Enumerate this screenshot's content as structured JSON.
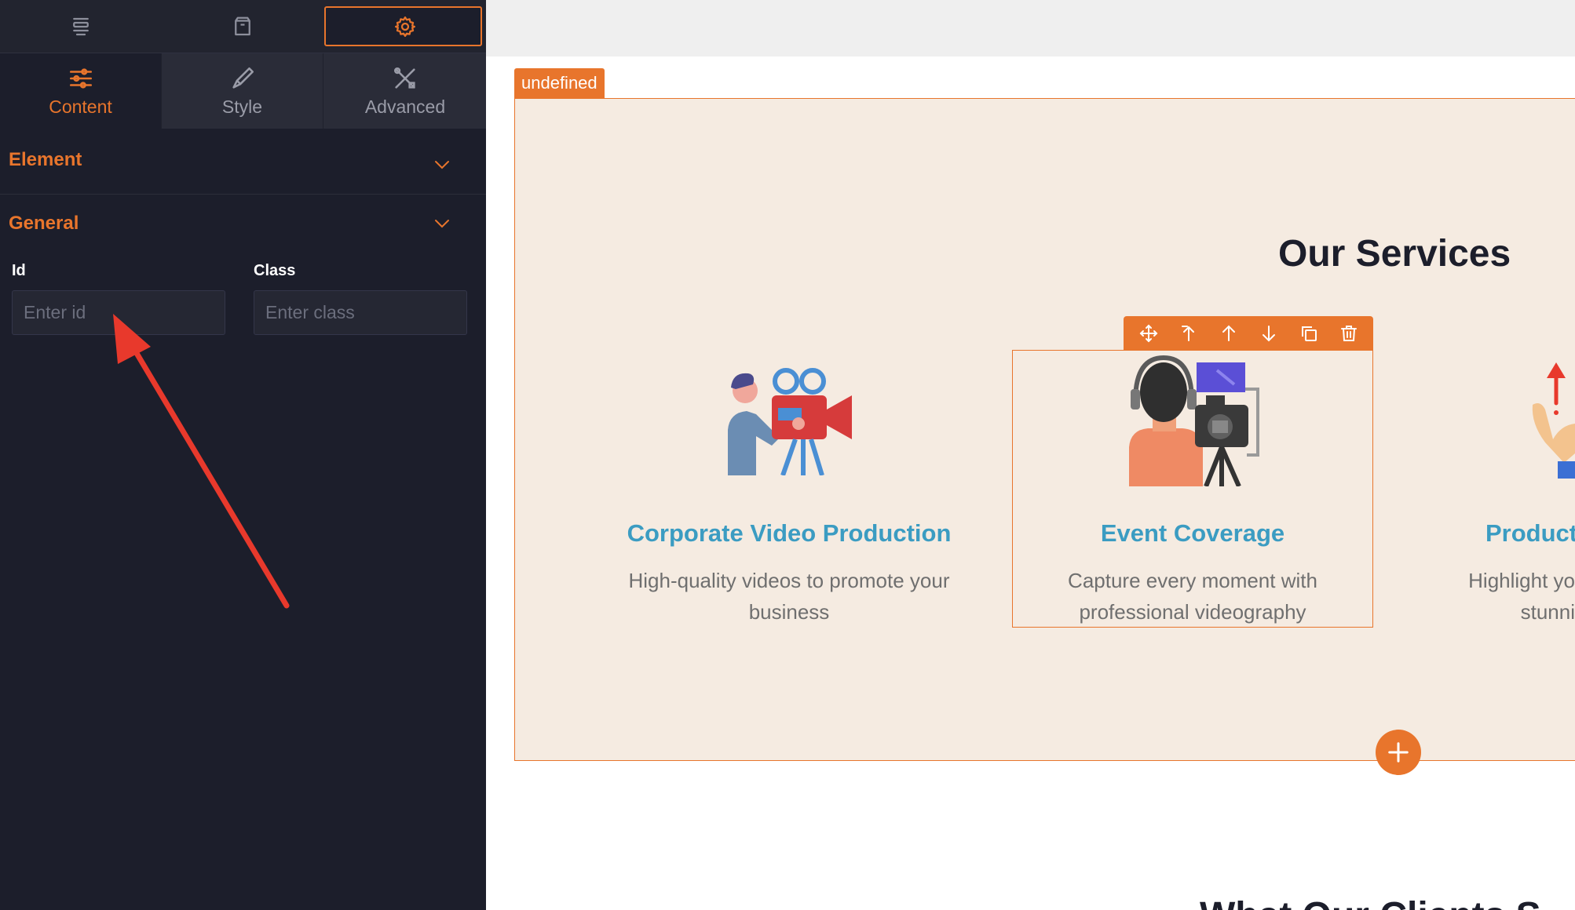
{
  "top_tabs": [
    {
      "icon": "layers-icon",
      "active": false
    },
    {
      "icon": "box-icon",
      "active": false
    },
    {
      "icon": "gear-icon",
      "active": true
    }
  ],
  "sub_tabs": [
    {
      "label": "Content",
      "icon": "sliders-icon",
      "active": true
    },
    {
      "label": "Style",
      "icon": "brush-icon",
      "active": false
    },
    {
      "label": "Advanced",
      "icon": "tools-icon",
      "active": false
    }
  ],
  "sections": {
    "element": {
      "title": "Element"
    },
    "general": {
      "title": "General"
    }
  },
  "fields": {
    "id": {
      "label": "Id",
      "placeholder": "Enter id",
      "value": ""
    },
    "class": {
      "label": "Class",
      "placeholder": "Enter class",
      "value": ""
    }
  },
  "canvas": {
    "selection_label": "undefined",
    "services_title": "Our Services",
    "cards": [
      {
        "title": "Corporate Video Production",
        "description": "High-quality videos to promote your business"
      },
      {
        "title": "Event Coverage",
        "description": "Capture every moment with professional videography"
      },
      {
        "title": "Product",
        "description": "Highlight yo stunni"
      }
    ],
    "card_toolbar": [
      "move-icon",
      "move-up-level-icon",
      "arrow-up-icon",
      "arrow-down-icon",
      "duplicate-icon",
      "trash-icon"
    ],
    "next_heading": "What Our Clients S"
  },
  "colors": {
    "accent": "#e8752c",
    "panel_bg": "#1c1e2b",
    "card_title": "#3b9cc2",
    "section_bg": "#f5ebe1"
  }
}
